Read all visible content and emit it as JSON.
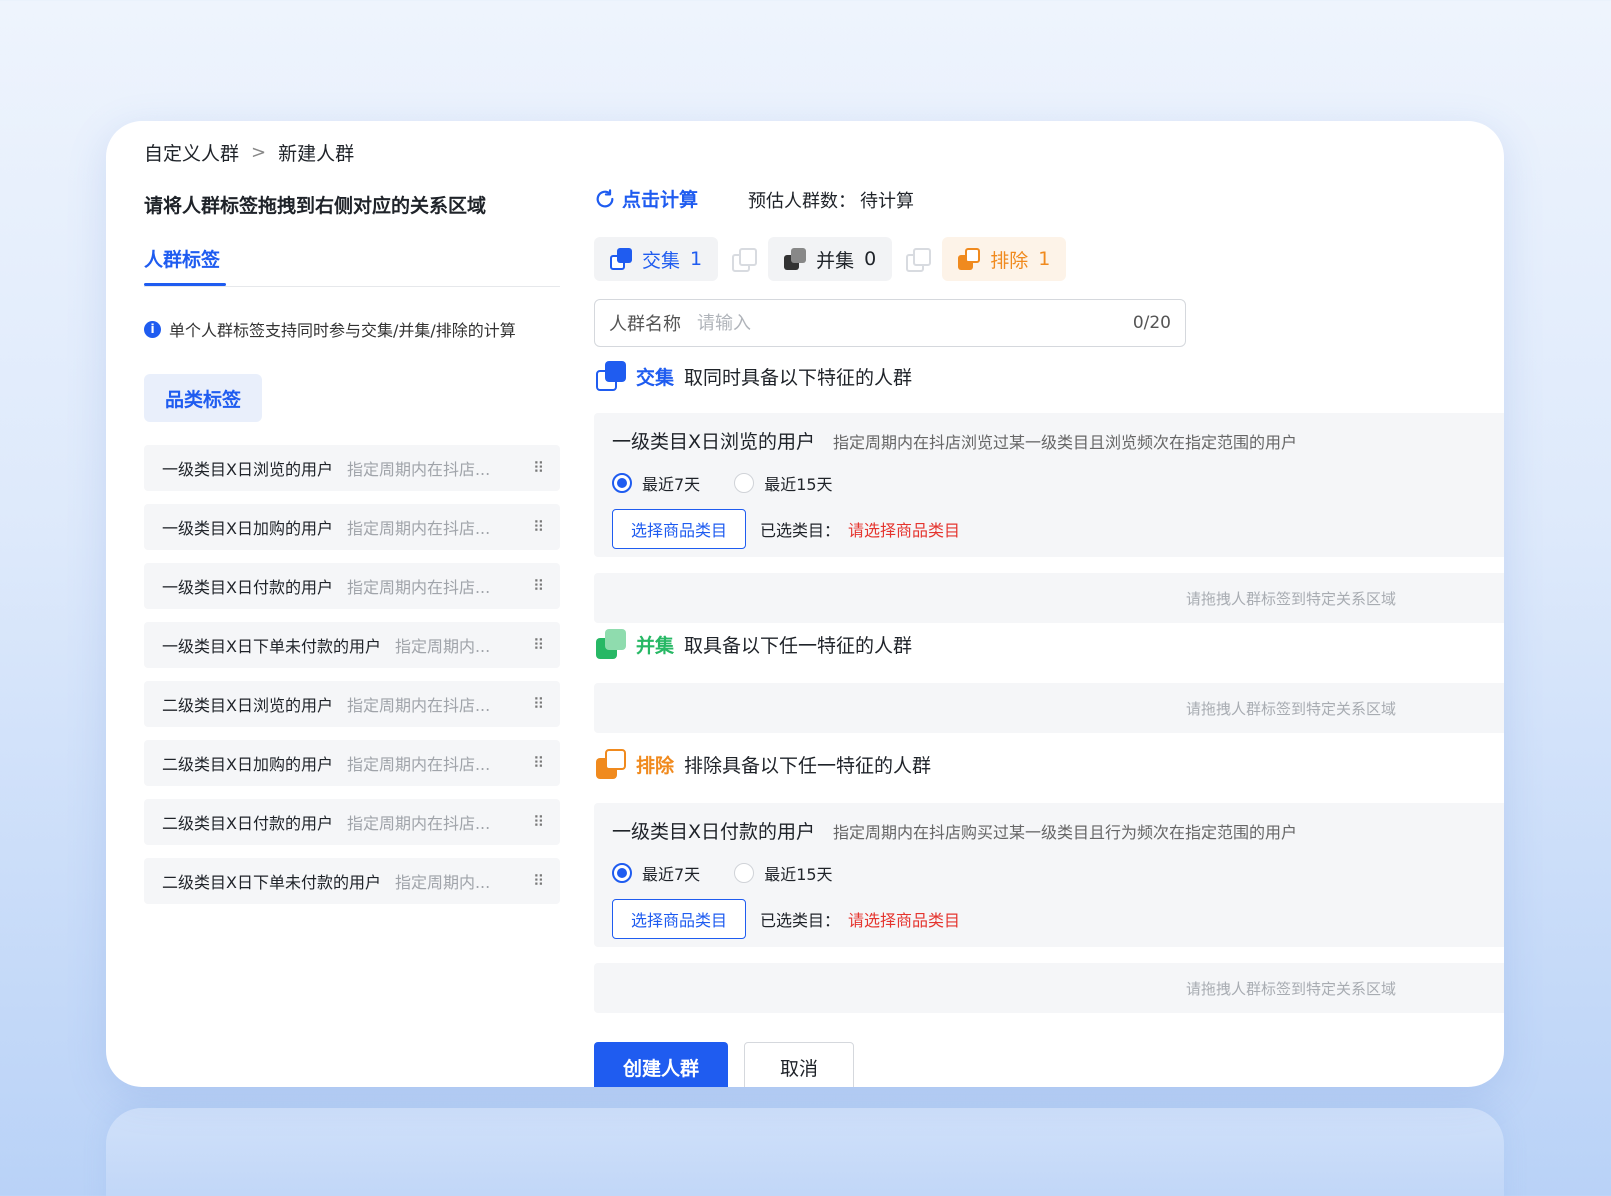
{
  "breadcrumb": {
    "parent": "自定义人群",
    "separator": ">",
    "current": "新建人群"
  },
  "left": {
    "title": "请将人群标签拖拽到右侧对应的关系区域",
    "tab": "人群标签",
    "notice": "单个人群标签支持同时参与交集/并集/排除的计算",
    "notice_icon": "i",
    "category_tag": "品类标签",
    "labels": [
      {
        "name": "一级类目X日浏览的用户",
        "desc": "指定周期内在抖店..."
      },
      {
        "name": "一级类目X日加购的用户",
        "desc": "指定周期内在抖店..."
      },
      {
        "name": "一级类目X日付款的用户",
        "desc": "指定周期内在抖店..."
      },
      {
        "name": "一级类目X日下单未付款的用户",
        "desc": "指定周期内..."
      },
      {
        "name": "二级类目X日浏览的用户",
        "desc": "指定周期内在抖店..."
      },
      {
        "name": "二级类目X日加购的用户",
        "desc": "指定周期内在抖店..."
      },
      {
        "name": "二级类目X日付款的用户",
        "desc": "指定周期内在抖店..."
      },
      {
        "name": "二级类目X日下单未付款的用户",
        "desc": "指定周期内..."
      }
    ],
    "drag_glyph": "⠿"
  },
  "right": {
    "calc_label": "点击计算",
    "estimate_label": "预估人群数：",
    "estimate_value": "待计算",
    "toolbar": {
      "intersection": {
        "label": "交集",
        "count": "1"
      },
      "union": {
        "label": "并集",
        "count": "0"
      },
      "exclude": {
        "label": "排除",
        "count": "1"
      }
    },
    "name_input": {
      "label": "人群名称",
      "placeholder": "请输入",
      "counter": "0/20"
    },
    "intersection": {
      "title": "交集",
      "desc": "取同时具备以下特征的人群",
      "item": {
        "name": "一级类目X日浏览的用户",
        "desc": "指定周期内在抖店浏览过某一级类目且浏览频次在指定范围的用户",
        "radio_1": "最近7天",
        "radio_2": "最近15天",
        "pick_button": "选择商品类目",
        "selected_label": "已选类目：",
        "selected_value": "请选择商品类目"
      },
      "drop_hint": "请拖拽人群标签到特定关系区域"
    },
    "union": {
      "title": "并集",
      "desc": "取具备以下任一特征的人群",
      "drop_hint": "请拖拽人群标签到特定关系区域"
    },
    "exclude": {
      "title": "排除",
      "desc": "排除具备以下任一特征的人群",
      "item": {
        "name": "一级类目X日付款的用户",
        "desc": "指定周期内在抖店购买过某一级类目且行为频次在指定范围的用户",
        "radio_1": "最近7天",
        "radio_2": "最近15天",
        "pick_button": "选择商品类目",
        "selected_label": "已选类目：",
        "selected_value": "请选择商品类目"
      },
      "drop_hint": "请拖拽人群标签到特定关系区域"
    },
    "create_button": "创建人群",
    "cancel_button": "取消"
  },
  "colors": {
    "primary": "#1f5cf0",
    "union": "#27b865",
    "exclude": "#f08a1e",
    "warn": "#e5352f"
  }
}
